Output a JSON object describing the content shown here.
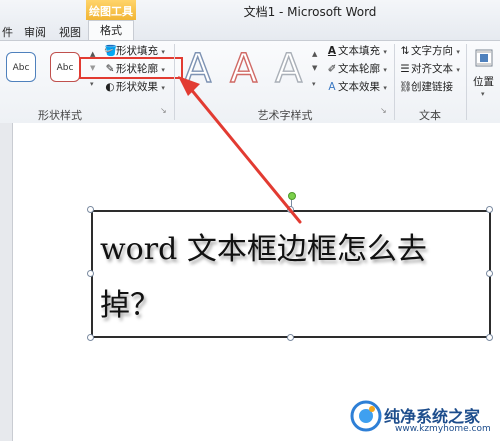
{
  "window": {
    "contextual_group": "绘图工具",
    "document_title": "文档1 - Microsoft Word"
  },
  "tabs": [
    "件",
    "审阅",
    "视图",
    "格式"
  ],
  "ribbon": {
    "shape_styles": {
      "label": "形状样式",
      "presets": [
        "Abc",
        "Abc"
      ],
      "shape_fill": "形状填充",
      "shape_outline": "形状轮廓",
      "shape_effects": "形状效果"
    },
    "wordart_styles": {
      "label": "艺术字样式",
      "samples": [
        "A",
        "A",
        "A"
      ],
      "text_fill": "文本填充",
      "text_outline": "文本轮廓",
      "text_effects": "文本效果"
    },
    "text": {
      "label": "文本",
      "text_direction": "文字方向",
      "align_text": "对齐文本",
      "create_link": "创建链接"
    },
    "arrange": {
      "position": "位置"
    }
  },
  "document": {
    "textbox_line1": "word 文本框边框怎么去",
    "textbox_line2": "掉？"
  },
  "watermark": {
    "title": "纯净系统之家",
    "url": "www.kzmyhome.com"
  },
  "colors": {
    "contextual_tab": "#f1b534",
    "highlight": "#e23b32",
    "arrow": "#e23b32"
  }
}
